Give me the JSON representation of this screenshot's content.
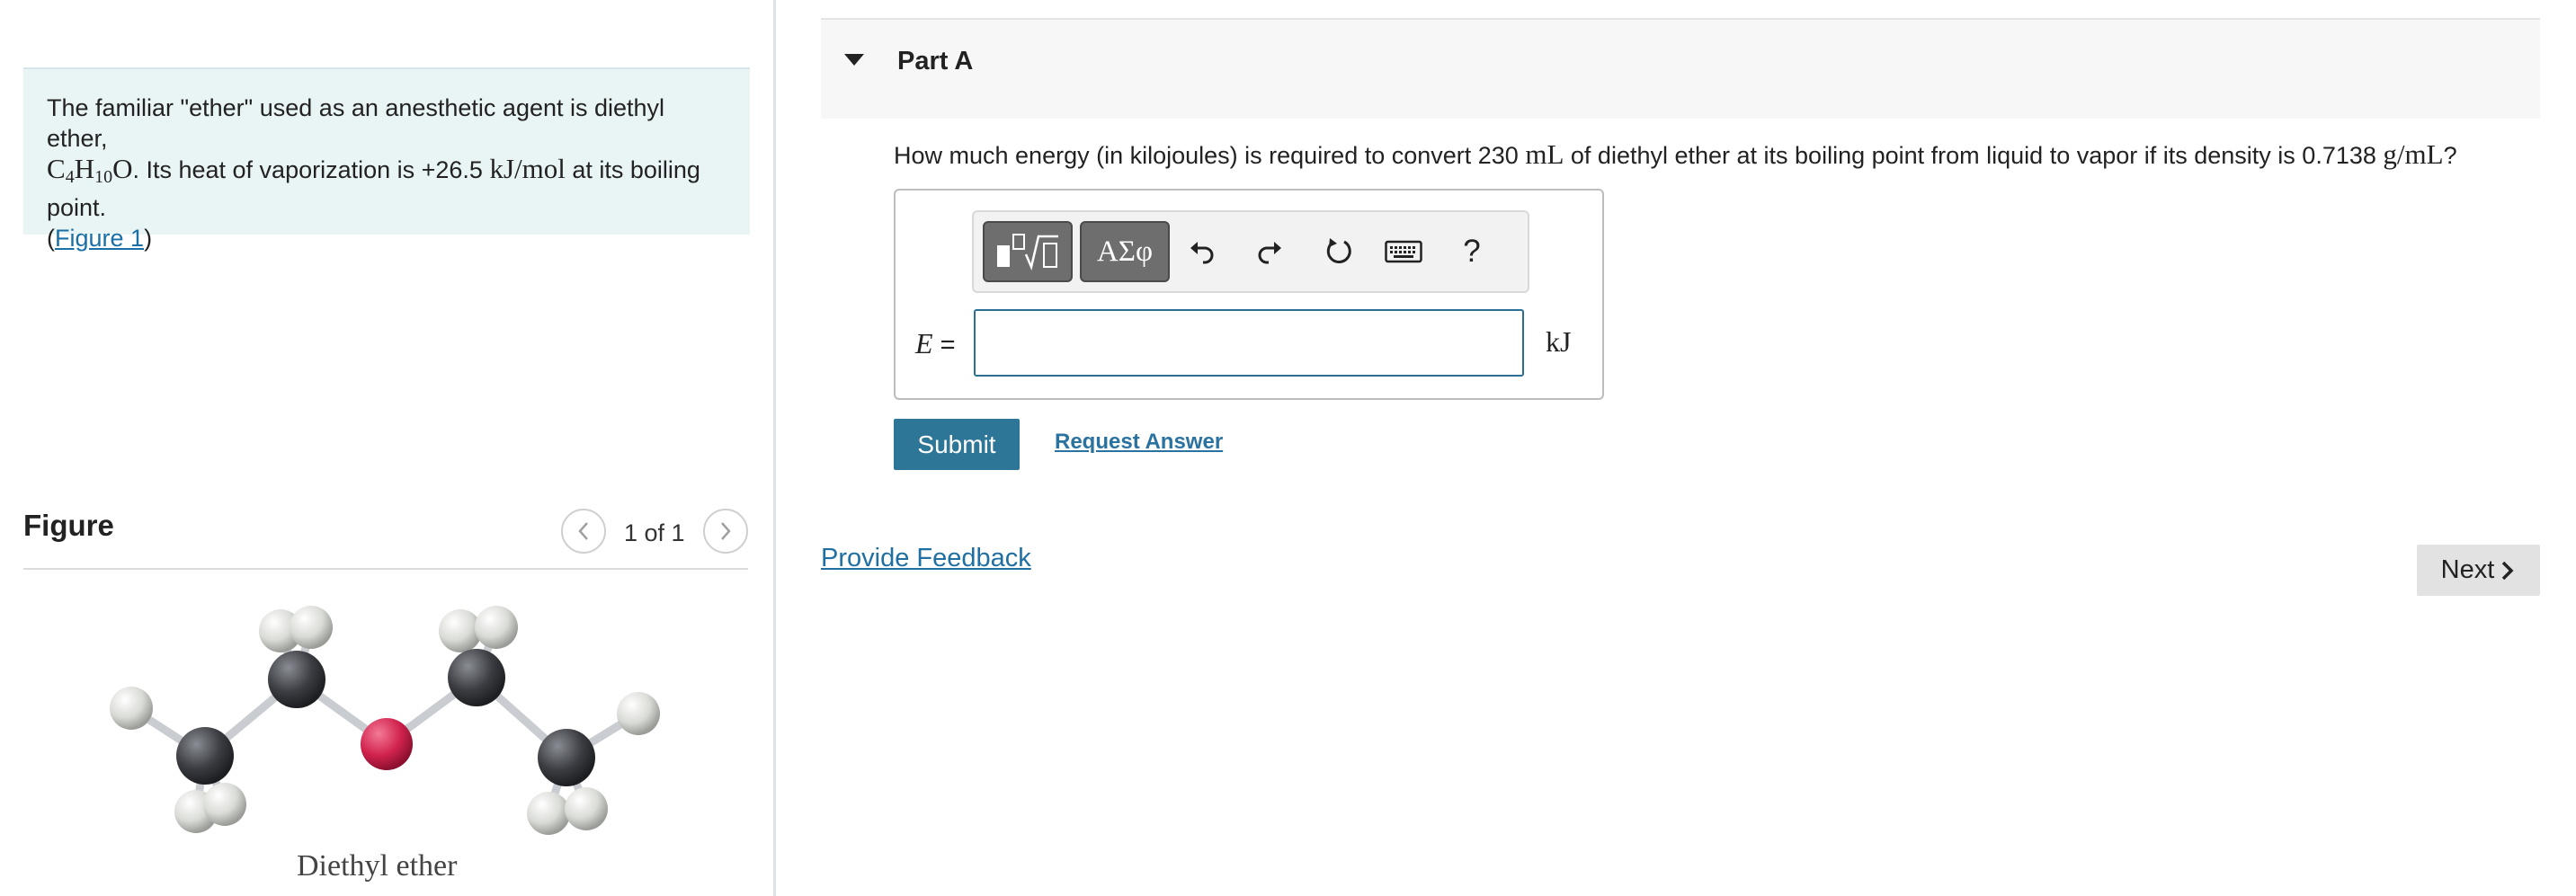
{
  "problem": {
    "text_1": "The familiar \"ether\" used as an anesthetic agent is diethyl ether,",
    "formula_c": "C",
    "formula_c_sub": "4",
    "formula_h": "H",
    "formula_h_sub": "10",
    "formula_o": "O",
    "text_2": ". Its heat of vaporization is +26.5 ",
    "unit_kjmol": "kJ/mol",
    "text_3": " at its boiling point.",
    "figure_link_open": "(",
    "figure_link": "Figure 1",
    "figure_link_close": ")"
  },
  "figure": {
    "title": "Figure",
    "count": "1 of 1",
    "prev_icon": "chevron-left-icon",
    "next_icon": "chevron-right-icon",
    "caption": "Diethyl ether",
    "colors": {
      "carbon": "#3b3d42",
      "hydrogen": "#d9dbd6",
      "oxygen": "#d1234e",
      "bond": "#c9ccd0"
    }
  },
  "part": {
    "title": "Part A",
    "toggle_icon": "caret-down-icon",
    "question_1": "How much energy (in kilojoules) is required to convert 230 ",
    "question_unit_ml": "mL",
    "question_2": " of diethyl ether at its boiling point from liquid to vapor if its density is 0.7138 ",
    "question_unit_gml": "g/mL",
    "question_3": "?"
  },
  "answer": {
    "toolbar": {
      "templates_icon": "templates-icon",
      "symbols_label": "ΑΣφ",
      "undo_icon": "undo-icon",
      "redo_icon": "redo-icon",
      "reset_icon": "reset-icon",
      "keyboard_icon": "keyboard-icon",
      "help_label": "?"
    },
    "variable": "E",
    "equals": " =",
    "value": "",
    "unit": "kJ"
  },
  "actions": {
    "submit_label": "Submit",
    "request_answer_label": "Request Answer",
    "provide_feedback_label": "Provide Feedback",
    "next_label": "Next",
    "next_icon": "chevron-right-icon"
  },
  "colors": {
    "accent": "#2e7697",
    "link": "#1f6fa3",
    "problem_bg": "#e9f4f5",
    "input_border": "#2b6f95"
  }
}
